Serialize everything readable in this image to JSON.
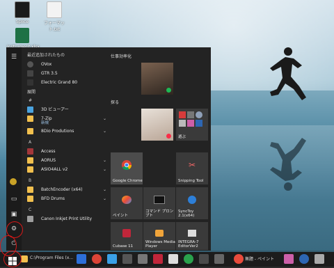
{
  "desktop_icons": [
    {
      "label": "Splice",
      "color": "#222"
    },
    {
      "label": "フォーマット.txt",
      "color": "#f3f3f3"
    },
    {
      "label": "Instrument.xlsx",
      "color": "#1e7145"
    }
  ],
  "start_menu": {
    "recent_header": "最近追加されたもの",
    "recent": [
      {
        "label": "OVox"
      },
      {
        "label": "GTR 3.5"
      },
      {
        "label": "Electric Grand 80"
      }
    ],
    "expand_label": "展開",
    "groups": [
      {
        "letter": "#",
        "items": [
          {
            "label": "3D ビューアー",
            "color": "#4aa3df"
          },
          {
            "label": "7-Zip",
            "sub": "新規",
            "color": "#f2c04e",
            "chevron": true
          },
          {
            "label": "8Dio Produtions",
            "color": "#f2c04e",
            "chevron": true
          }
        ]
      },
      {
        "letter": "A",
        "items": [
          {
            "label": "Access",
            "color": "#a4373a"
          },
          {
            "label": "AORUS",
            "color": "#f2c04e",
            "chevron": true
          },
          {
            "label": "ASIO4ALL v2",
            "color": "#f2c04e",
            "chevron": true
          }
        ]
      },
      {
        "letter": "B",
        "items": [
          {
            "label": "BatchEncoder (x64)",
            "color": "#f2c04e",
            "chevron": true
          },
          {
            "label": "BFD Drums",
            "color": "#f2c04e",
            "chevron": true
          }
        ]
      },
      {
        "letter": "C",
        "items": [
          {
            "label": "Canon Inkjet Print Utility",
            "color": "#9e9e9e"
          }
        ]
      }
    ],
    "tiles_header": "仕事効率化",
    "tiles_header2": "探る",
    "play_label": "遊ぶ",
    "tiles": [
      {
        "label": "Google Chrome"
      },
      {
        "label": "Snipping Tool"
      },
      {
        "label": "ペイント"
      },
      {
        "label": "コマンド プロンプト"
      },
      {
        "label": "SyncToy 2.1(x64)"
      },
      {
        "label": "Cubase 11"
      },
      {
        "label": "Windows Media Player"
      },
      {
        "label": "INTEGRA-7 EditorVer2"
      }
    ]
  },
  "taskbar": {
    "explorer_text": "C:\\Program Files (x...",
    "paint_text": "無題 - ペイント"
  }
}
